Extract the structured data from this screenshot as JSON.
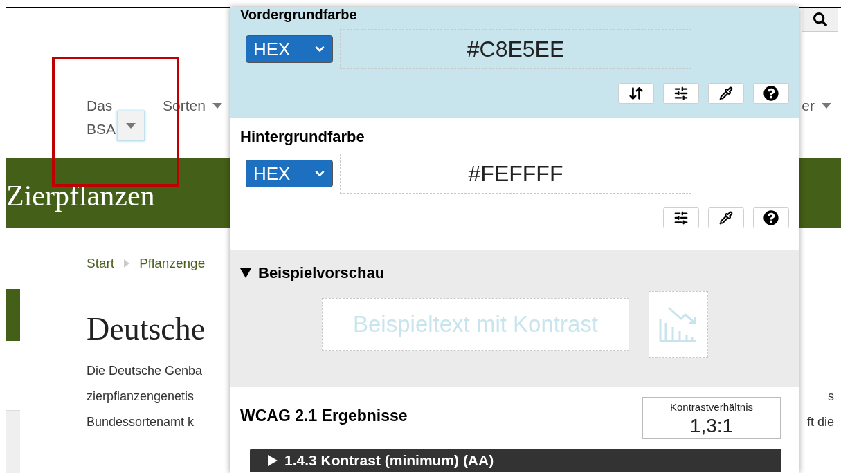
{
  "nav": [
    {
      "label": "Das BSA",
      "focused": true
    },
    {
      "label": "Sorten",
      "focused": false
    },
    {
      "label": "er",
      "focused": false
    }
  ],
  "banner_title": "Zierpflanzen",
  "breadcrumb": [
    "Start",
    "Pflanzenge"
  ],
  "heading": "Deutsche",
  "paragraph_rows": [
    {
      "left": "Die Deutsche Genba"
    },
    {
      "left": "zierpflanzengenetis",
      "right": "s"
    },
    {
      "left": "Bundessortenamt k",
      "right": "ft die"
    }
  ],
  "contrast_panel": {
    "colors": [
      {
        "kind": "foreground",
        "heading": "Vordergrundfarbe",
        "format": "HEX",
        "value": "#C8E5EE"
      },
      {
        "kind": "background",
        "heading": "Hintergrundfarbe",
        "format": "HEX",
        "value": "#FEFFFF"
      }
    ],
    "preview": {
      "heading": "Beispielvorschau",
      "expanded": true,
      "sample_text": "Beispieltext mit Kontrast"
    },
    "results": {
      "heading": "WCAG 2.1 Ergebnisse",
      "ratio_label": "Kontrastverhältnis",
      "ratio": "1,3:1",
      "criteria": [
        {
          "label": "1.4.3 Kontrast (minimum) (AA)",
          "expanded": false
        }
      ]
    }
  }
}
